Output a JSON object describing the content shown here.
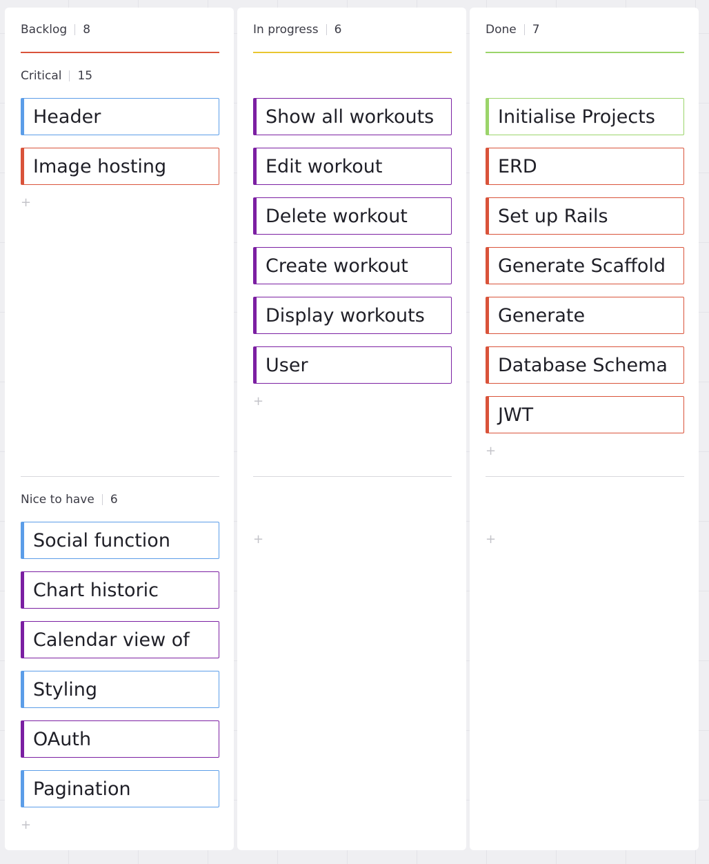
{
  "columns": [
    {
      "title": "Backlog",
      "count": "8",
      "accent": "#d9533a",
      "groups": [
        {
          "title": "Critical",
          "count": "15",
          "cards": [
            {
              "label": "Header",
              "color": "blue"
            },
            {
              "label": "Image hosting",
              "color": "red"
            }
          ]
        },
        {
          "title": "Nice to have",
          "count": "6",
          "cards": [
            {
              "label": "Social function",
              "color": "blue"
            },
            {
              "label": "Chart historic",
              "color": "purple"
            },
            {
              "label": "Calendar view of",
              "color": "purple"
            },
            {
              "label": "Styling",
              "color": "blue"
            },
            {
              "label": "OAuth",
              "color": "purple"
            },
            {
              "label": "Pagination",
              "color": "blue"
            }
          ]
        }
      ]
    },
    {
      "title": "In progress",
      "count": "6",
      "accent": "#e8c630",
      "groups": [
        {
          "title": "",
          "count": "",
          "cards": [
            {
              "label": "Show all workouts",
              "color": "purple"
            },
            {
              "label": "Edit workout",
              "color": "purple"
            },
            {
              "label": "Delete workout",
              "color": "purple"
            },
            {
              "label": "Create workout",
              "color": "purple"
            },
            {
              "label": "Display workouts",
              "color": "purple"
            },
            {
              "label": "User",
              "color": "purple"
            }
          ]
        },
        {
          "title": "",
          "count": "",
          "cards": []
        }
      ]
    },
    {
      "title": "Done",
      "count": "7",
      "accent": "#9bd46a",
      "groups": [
        {
          "title": "",
          "count": "",
          "cards": [
            {
              "label": "Initialise Projects",
              "color": "green"
            },
            {
              "label": "ERD",
              "color": "red"
            },
            {
              "label": "Set up Rails",
              "color": "red"
            },
            {
              "label": "Generate Scaffold",
              "color": "red"
            },
            {
              "label": "Generate",
              "color": "red"
            },
            {
              "label": "Database Schema",
              "color": "red"
            },
            {
              "label": "JWT",
              "color": "red"
            }
          ]
        },
        {
          "title": "",
          "count": "",
          "cards": []
        }
      ]
    }
  ],
  "add_icon": "plus-icon",
  "add_glyph": "+"
}
